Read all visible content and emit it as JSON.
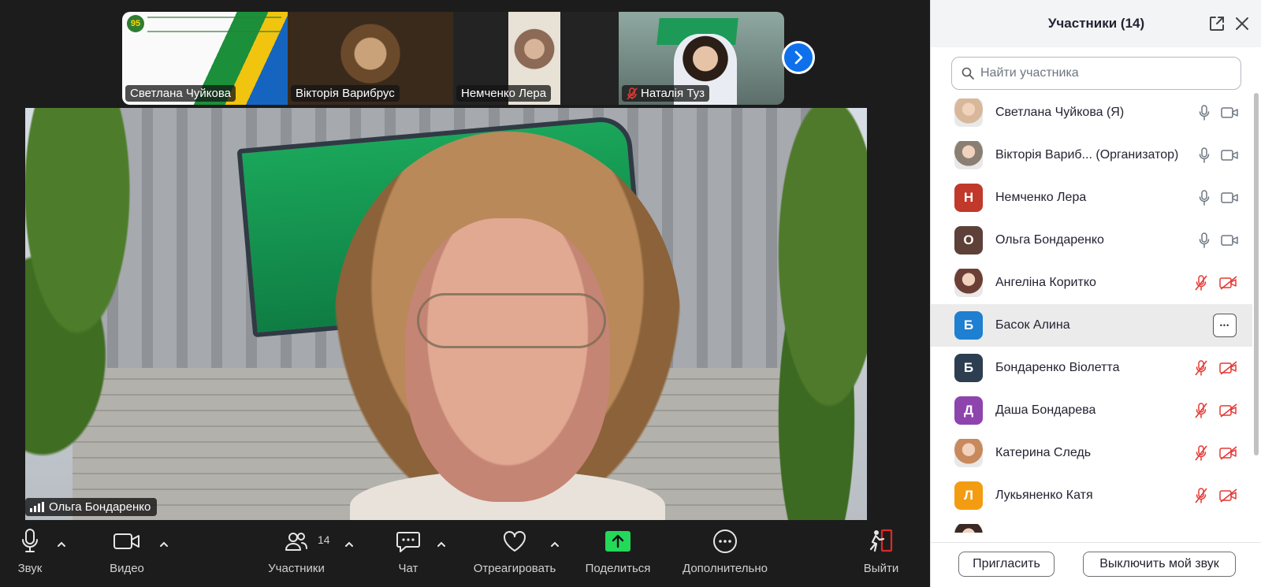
{
  "thumbnails": [
    {
      "name": "Светлана Чуйкова",
      "muted": false
    },
    {
      "name": "Вікторія Варибрус",
      "muted": false
    },
    {
      "name": "Немченко Лера",
      "muted": false
    },
    {
      "name": "Наталія Туз",
      "muted": true
    }
  ],
  "thumb_logo_text": "95",
  "main_speaker": "Ольга Бондаренко",
  "toolbar": {
    "audio": "Звук",
    "video": "Видео",
    "participants": "Участники",
    "participants_count": "14",
    "chat": "Чат",
    "react": "Отреагировать",
    "share": "Поделиться",
    "more": "Дополнительно",
    "leave": "Выйти"
  },
  "panel": {
    "title": "Участники (14)",
    "search_placeholder": "Найти участника",
    "invite": "Пригласить",
    "mute_me": "Выключить мой звук"
  },
  "participants": [
    {
      "name": "Светлана Чуйкова (Я)",
      "avatar": "photo",
      "avatar_color": "#d8b89a",
      "mic": "on",
      "cam": "on"
    },
    {
      "name": "Вікторія Вариб...  (Организатор)",
      "avatar": "photo",
      "avatar_color": "#8a7f72",
      "mic": "on",
      "cam": "on"
    },
    {
      "name": "Немченко Лера",
      "avatar": "Н",
      "avatar_color": "#c0392b",
      "mic": "on",
      "cam": "on"
    },
    {
      "name": "Ольга Бондаренко",
      "avatar": "О",
      "avatar_color": "#5d4037",
      "mic": "on",
      "cam": "on"
    },
    {
      "name": "Ангеліна Коритко",
      "avatar": "photo",
      "avatar_color": "#6b3f35",
      "mic": "off",
      "cam": "off"
    },
    {
      "name": "Басок Алина",
      "avatar": "Б",
      "avatar_color": "#1f7fd1",
      "mic": "none",
      "cam": "none"
    },
    {
      "name": "Бондаренко Віолетта",
      "avatar": "Б",
      "avatar_color": "#2c3e50",
      "mic": "off",
      "cam": "off"
    },
    {
      "name": "Даша Бондарева",
      "avatar": "Д",
      "avatar_color": "#8e44ad",
      "mic": "off",
      "cam": "off"
    },
    {
      "name": "Катерина Следь",
      "avatar": "photo",
      "avatar_color": "#c8895c",
      "mic": "off",
      "cam": "off"
    },
    {
      "name": "Лукьяненко Катя",
      "avatar": "Л",
      "avatar_color": "#f39c12",
      "mic": "off",
      "cam": "off"
    }
  ],
  "colors": {
    "accent": "#0e71eb",
    "share_green": "#23d959",
    "leave_red": "#e02828",
    "muted_red": "#e53935",
    "panel_bg": "#ffffff"
  }
}
